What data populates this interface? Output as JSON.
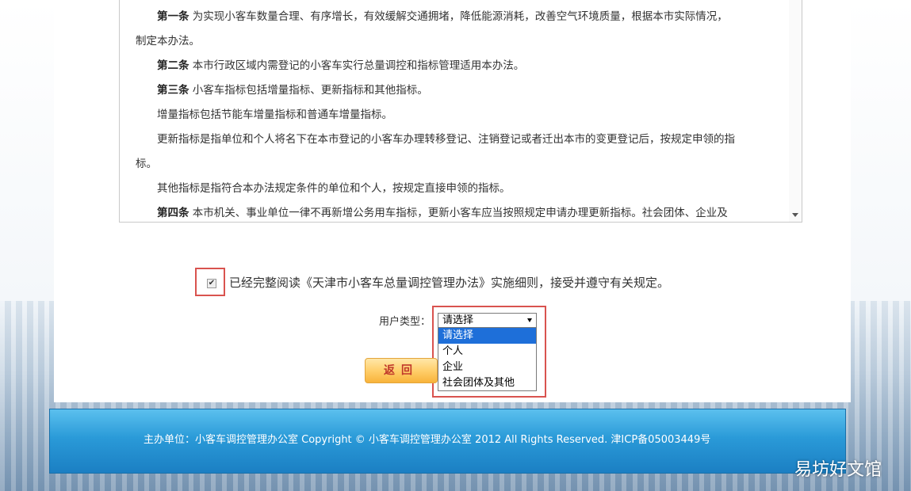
{
  "terms": {
    "p1_article": "第一条",
    "p1_text": " 为实现小客车数量合理、有序增长，有效缓解交通拥堵，降低能源消耗，改善空气环境质量，根据本市实际情况，",
    "p1_cont": "制定本办法。",
    "p2_article": "第二条",
    "p2_text": " 本市行政区域内需登记的小客车实行总量调控和指标管理适用本办法。",
    "p3_article": "第三条",
    "p3_text": " 小客车指标包括增量指标、更新指标和其他指标。",
    "p4_text": "增量指标包括节能车增量指标和普通车增量指标。",
    "p5_text": "更新指标是指单位和个人将名下在本市登记的小客车办理转移登记、注销登记或者迁出本市的变更登记后，按规定申领的指",
    "p5_cont": "标。",
    "p6_text": "其他指标是指符合本办法规定条件的单位和个人，按规定直接申领的指标。",
    "p7_article": "第四条",
    "p7_text": " 本市机关、事业单位一律不再新增公务用车指标，更新小客车应当按照规定申请办理更新指标。社会团体、企业及"
  },
  "agreement": {
    "checked_mark": "✔",
    "text": "已经完整阅读《天津市小客车总量调控管理办法》实施细则，接受并遵守有关规定。"
  },
  "user_type": {
    "label": "用户类型：",
    "selected": "请选择",
    "options": [
      "请选择",
      "个人",
      "企业",
      "社会团体及其他"
    ]
  },
  "buttons": {
    "back": "返回"
  },
  "footer": {
    "text": "主办单位：小客车调控管理办公室  Copyright ©  小客车调控管理办公室    2012  All Rights Reserved.  津ICP备05003449号"
  },
  "watermark": "易坊好文馆"
}
